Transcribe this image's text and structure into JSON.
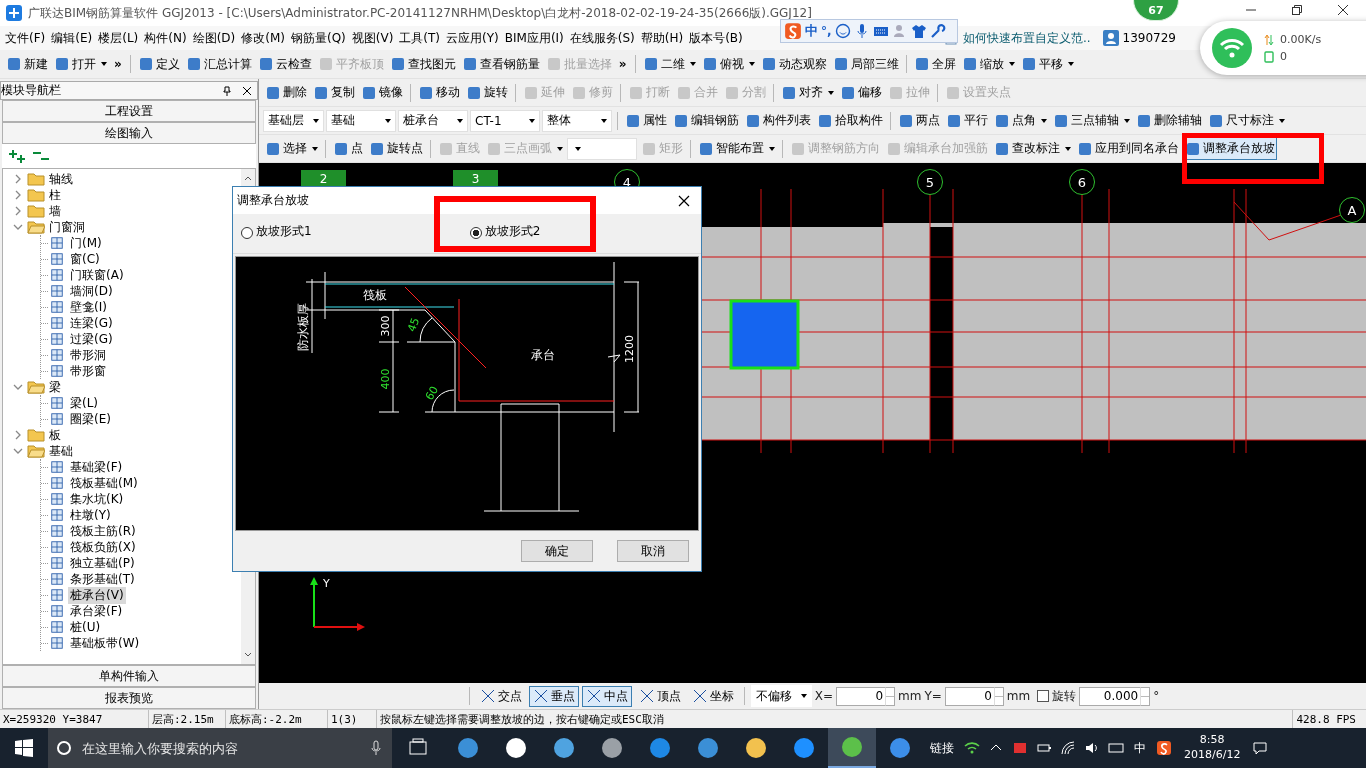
{
  "window": {
    "title": "广联达BIM钢筋算量软件 GGJ2013 - [C:\\Users\\Administrator.PC-20141127NRHM\\Desktop\\白龙村-2018-02-02-19-24-35(2666版).GGJ12]"
  },
  "notification_badge": "67",
  "menu": [
    "文件(F)",
    "编辑(E)",
    "楼层(L)",
    "构件(N)",
    "绘图(D)",
    "修改(M)",
    "钢筋量(Q)",
    "视图(V)",
    "工具(T)",
    "云应用(Y)",
    "BIM应用(I)",
    "在线服务(S)",
    "帮助(H)",
    "版本号(B)"
  ],
  "menu_extras": {
    "help_tab": "如何快速布置自定义范..",
    "account": "1390729"
  },
  "ime_toolbar": {
    "mode": "中",
    "punctuation": "°,"
  },
  "network_widget": {
    "speed": "0.00K/s",
    "count": "0"
  },
  "toolbar_top": [
    {
      "kind": "button",
      "label": "新建",
      "disabled": false
    },
    {
      "kind": "button",
      "label": "打开",
      "disabled": false,
      "dropdown": true
    },
    {
      "kind": "overflow",
      "label": "»"
    },
    {
      "kind": "separator"
    },
    {
      "kind": "button",
      "label": "定义",
      "disabled": false
    },
    {
      "kind": "button",
      "label": "汇总计算",
      "disabled": false
    },
    {
      "kind": "button",
      "label": "云检查",
      "disabled": false
    },
    {
      "kind": "button",
      "label": "平齐板顶",
      "disabled": true
    },
    {
      "kind": "button",
      "label": "查找图元",
      "disabled": false
    },
    {
      "kind": "button",
      "label": "查看钢筋量",
      "disabled": false
    },
    {
      "kind": "button",
      "label": "批量选择",
      "disabled": true
    },
    {
      "kind": "overflow",
      "label": "»"
    },
    {
      "kind": "separator"
    },
    {
      "kind": "button",
      "label": "二维",
      "disabled": false,
      "dropdown": true
    },
    {
      "kind": "button",
      "label": "俯视",
      "disabled": false,
      "dropdown": true
    },
    {
      "kind": "button",
      "label": "动态观察",
      "disabled": false
    },
    {
      "kind": "button",
      "label": "局部三维",
      "disabled": false
    },
    {
      "kind": "separator"
    },
    {
      "kind": "button",
      "label": "全屏",
      "disabled": false
    },
    {
      "kind": "button",
      "label": "缩放",
      "disabled": false,
      "dropdown": true
    },
    {
      "kind": "button",
      "label": "平移",
      "disabled": false,
      "dropdown": true
    }
  ],
  "toolbars": [
    [
      {
        "kind": "button",
        "label": "删除",
        "disabled": false
      },
      {
        "kind": "button",
        "label": "复制",
        "disabled": false
      },
      {
        "kind": "button",
        "label": "镜像",
        "disabled": false
      },
      {
        "kind": "separator"
      },
      {
        "kind": "button",
        "label": "移动",
        "disabled": false
      },
      {
        "kind": "button",
        "label": "旋转",
        "disabled": false
      },
      {
        "kind": "separator"
      },
      {
        "kind": "button",
        "label": "延伸",
        "disabled": true
      },
      {
        "kind": "button",
        "label": "修剪",
        "disabled": true
      },
      {
        "kind": "separator"
      },
      {
        "kind": "button",
        "label": "打断",
        "disabled": true
      },
      {
        "kind": "button",
        "label": "合并",
        "disabled": true
      },
      {
        "kind": "button",
        "label": "分割",
        "disabled": true
      },
      {
        "kind": "separator"
      },
      {
        "kind": "button",
        "label": "对齐",
        "disabled": false,
        "dropdown": true
      },
      {
        "kind": "button",
        "label": "偏移",
        "disabled": false
      },
      {
        "kind": "button",
        "label": "拉伸",
        "disabled": true
      },
      {
        "kind": "separator"
      },
      {
        "kind": "button",
        "label": "设置夹点",
        "disabled": true
      }
    ],
    [
      {
        "kind": "combo",
        "value": "基础层"
      },
      {
        "kind": "combo",
        "value": "基础"
      },
      {
        "kind": "combo",
        "value": "桩承台"
      },
      {
        "kind": "combo",
        "value": "CT-1"
      },
      {
        "kind": "combo",
        "value": "整体"
      },
      {
        "kind": "separator"
      },
      {
        "kind": "button",
        "label": "属性",
        "disabled": false
      },
      {
        "kind": "button",
        "label": "编辑钢筋",
        "disabled": false
      },
      {
        "kind": "button",
        "label": "构件列表",
        "disabled": false
      },
      {
        "kind": "button",
        "label": "拾取构件",
        "disabled": false
      },
      {
        "kind": "separator"
      },
      {
        "kind": "button",
        "label": "两点",
        "disabled": false
      },
      {
        "kind": "button",
        "label": "平行",
        "disabled": false
      },
      {
        "kind": "button",
        "label": "点角",
        "disabled": false,
        "dropdown": true
      },
      {
        "kind": "button",
        "label": "三点辅轴",
        "disabled": false,
        "dropdown": true
      },
      {
        "kind": "button",
        "label": "删除辅轴",
        "disabled": false
      },
      {
        "kind": "button",
        "label": "尺寸标注",
        "disabled": false,
        "dropdown": true
      }
    ],
    [
      {
        "kind": "button",
        "label": "选择",
        "disabled": false,
        "dropdown": true,
        "selected": false
      },
      {
        "kind": "separator"
      },
      {
        "kind": "button",
        "label": "点",
        "disabled": false,
        "selected": false
      },
      {
        "kind": "button",
        "label": "旋转点",
        "disabled": false,
        "selected": false
      },
      {
        "kind": "separator"
      },
      {
        "kind": "button",
        "label": "直线",
        "disabled": true,
        "selected": false
      },
      {
        "kind": "button",
        "label": "三点画弧",
        "disabled": true,
        "dropdown": true,
        "selected": false
      },
      {
        "kind": "combo"
      },
      {
        "kind": "button",
        "label": "矩形",
        "disabled": true,
        "selected": false
      },
      {
        "kind": "separator"
      },
      {
        "kind": "button",
        "label": "智能布置",
        "disabled": false,
        "dropdown": true,
        "selected": false
      },
      {
        "kind": "separator"
      },
      {
        "kind": "button",
        "label": "调整钢筋方向",
        "disabled": true,
        "selected": false
      },
      {
        "kind": "button",
        "label": "编辑承台加强筋",
        "disabled": true,
        "selected": false
      },
      {
        "kind": "button",
        "label": "查改标注",
        "disabled": false,
        "dropdown": true,
        "selected": false
      },
      {
        "kind": "button",
        "label": "应用到同名承台",
        "disabled": false,
        "selected": false
      },
      {
        "kind": "button",
        "label": "调整承台放坡",
        "disabled": false,
        "selected": true
      }
    ]
  ],
  "nav_panel": {
    "title": "模块导航栏",
    "sections_top": [
      "工程设置",
      "绘图输入"
    ],
    "tree": [
      {
        "label": "轴线",
        "expanded": false
      },
      {
        "label": "柱",
        "expanded": false
      },
      {
        "label": "墙",
        "expanded": false
      },
      {
        "label": "门窗洞",
        "expanded": true,
        "children": [
          {
            "label": "门(M)",
            "selected": false
          },
          {
            "label": "窗(C)",
            "selected": false
          },
          {
            "label": "门联窗(A)",
            "selected": false
          },
          {
            "label": "墙洞(D)",
            "selected": false
          },
          {
            "label": "壁龛(I)",
            "selected": false
          },
          {
            "label": "连梁(G)",
            "selected": false
          },
          {
            "label": "过梁(G)",
            "selected": false
          },
          {
            "label": "带形洞",
            "selected": false
          },
          {
            "label": "带形窗",
            "selected": false
          }
        ]
      },
      {
        "label": "梁",
        "expanded": true,
        "children": [
          {
            "label": "梁(L)",
            "selected": false
          },
          {
            "label": "圈梁(E)",
            "selected": false
          }
        ]
      },
      {
        "label": "板",
        "expanded": false
      },
      {
        "label": "基础",
        "expanded": true,
        "children": [
          {
            "label": "基础梁(F)",
            "selected": false
          },
          {
            "label": "筏板基础(M)",
            "selected": false
          },
          {
            "label": "集水坑(K)",
            "selected": false
          },
          {
            "label": "柱墩(Y)",
            "selected": false
          },
          {
            "label": "筏板主筋(R)",
            "selected": false
          },
          {
            "label": "筏板负筋(X)",
            "selected": false
          },
          {
            "label": "独立基础(P)",
            "selected": false
          },
          {
            "label": "条形基础(T)",
            "selected": false
          },
          {
            "label": "桩承台(V)",
            "selected": true
          },
          {
            "label": "承台梁(F)",
            "selected": false
          },
          {
            "label": "桩(U)",
            "selected": false
          },
          {
            "label": "基础板带(W)",
            "selected": false
          }
        ]
      }
    ],
    "sections_bottom": [
      "单构件输入",
      "报表预览"
    ]
  },
  "canvas": {
    "grid_markers": [
      {
        "label": "2",
        "kind": "box"
      },
      {
        "label": "3",
        "kind": "box"
      },
      {
        "label": "4",
        "kind": "circle"
      },
      {
        "label": "5",
        "kind": "circle"
      },
      {
        "label": "6",
        "kind": "circle"
      },
      {
        "label": "A",
        "kind": "circle"
      }
    ],
    "axis_label": "Y"
  },
  "dialog": {
    "title": "调整承台放坡",
    "options": [
      {
        "label": "放坡形式1",
        "selected": false
      },
      {
        "label": "放坡形式2",
        "selected": true
      }
    ],
    "diagram_labels": {
      "slab": "筏板",
      "waterproof": "防水板厚",
      "dim_upper": "300",
      "angle_upper": "45",
      "dim_lower": "400",
      "angle_lower": "60",
      "cap": "承台",
      "dim_total": "1200"
    },
    "buttons": [
      "确定",
      "取消"
    ]
  },
  "snap_toolbar": {
    "modes": [
      {
        "label": "交点",
        "selected": false
      },
      {
        "label": "垂点",
        "selected": true
      },
      {
        "label": "中点",
        "selected": true
      },
      {
        "label": "顶点",
        "selected": false
      },
      {
        "label": "坐标",
        "selected": false
      }
    ],
    "offset": "不偏移",
    "x_label": "X=",
    "x_value": "0",
    "x_unit": "mm",
    "y_label": "Y=",
    "y_value": "0",
    "y_unit": "mm",
    "rotate": {
      "label": "旋转",
      "checked": false,
      "value": "0.000",
      "unit": "°"
    }
  },
  "status_bar": [
    "X=259320 Y=3847",
    "层高:2.15m",
    "底标高:-2.2m",
    "1(3)",
    "按鼠标左键选择需要调整放坡的边，按右键确定或ESC取消",
    "428.8 FPS"
  ],
  "taskbar": {
    "search_placeholder": "在这里输入你要搜索的内容",
    "apps": [
      {
        "selected": false
      },
      {
        "selected": false
      },
      {
        "selected": false
      },
      {
        "selected": false
      },
      {
        "selected": false
      },
      {
        "selected": false
      },
      {
        "selected": false
      },
      {
        "selected": false
      },
      {
        "selected": true
      },
      {
        "selected": false
      }
    ],
    "tray_label": "链接",
    "ime": "中",
    "time": "8:58",
    "date": "2018/6/12"
  }
}
